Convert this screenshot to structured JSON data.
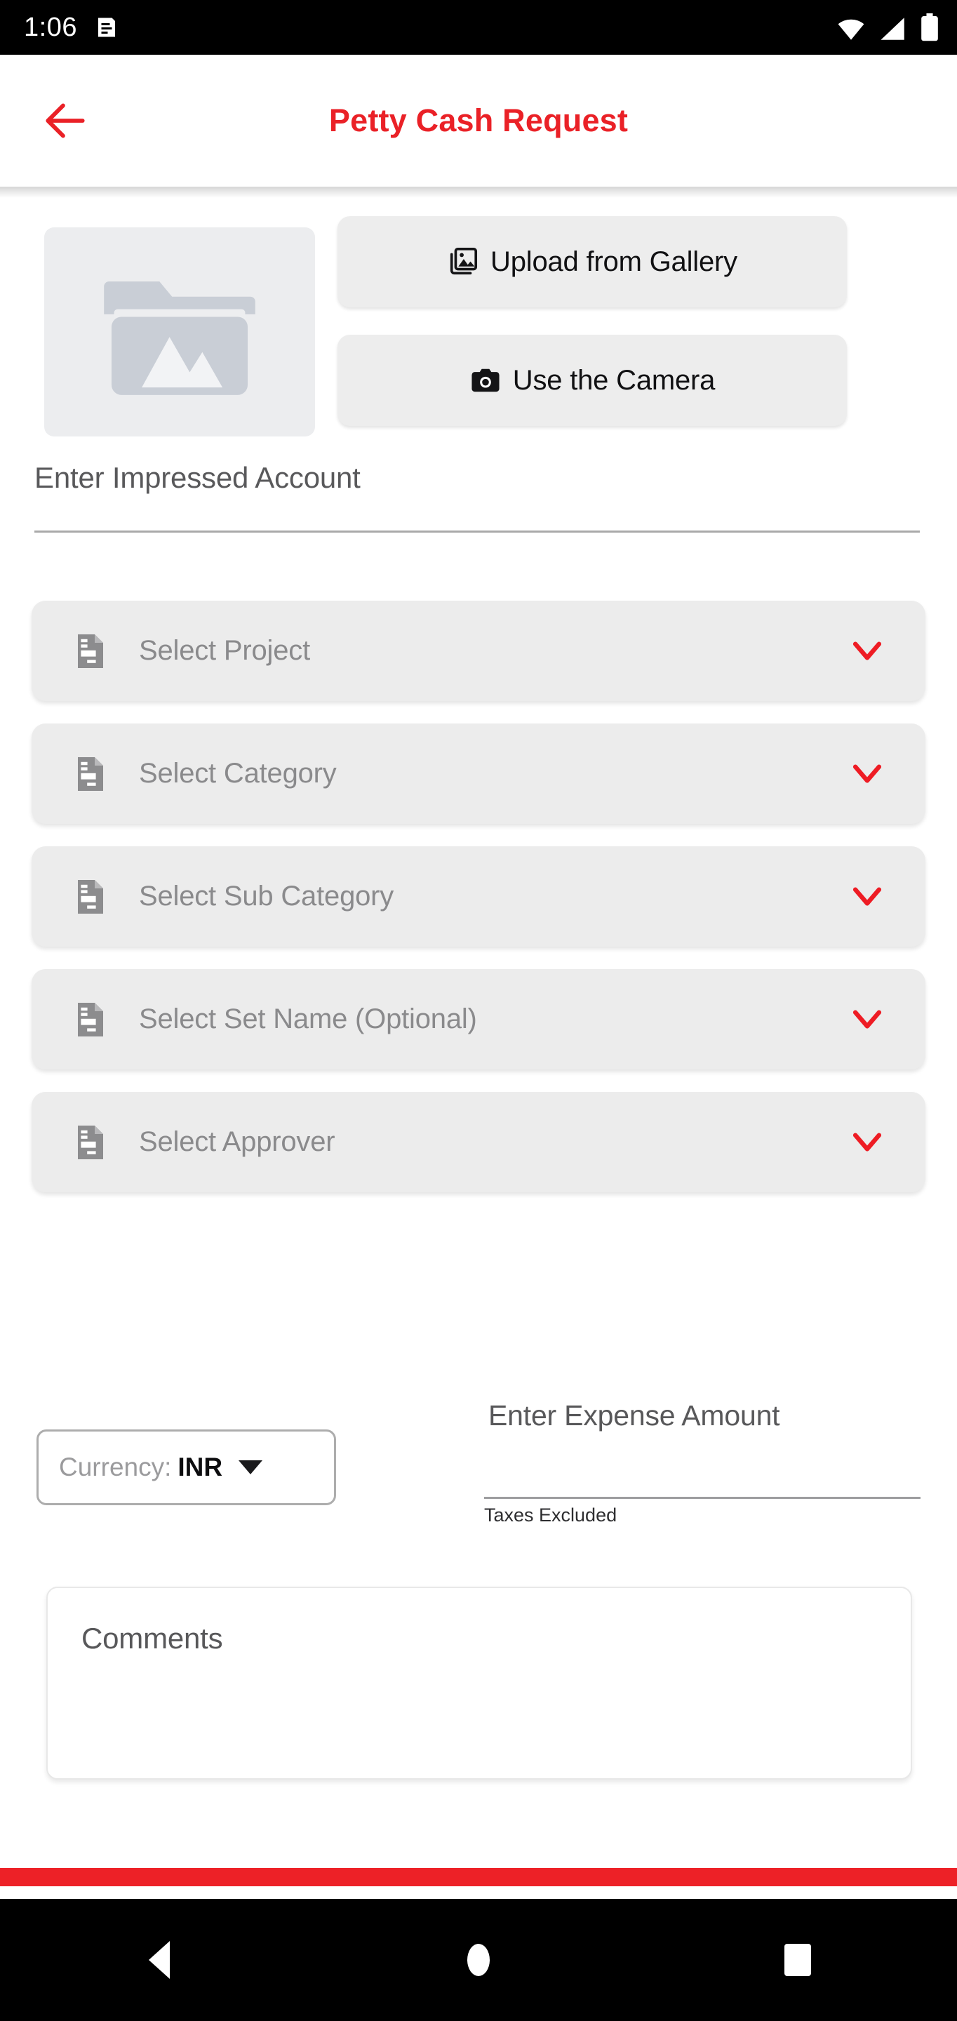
{
  "status_bar": {
    "time": "1:06",
    "icons": [
      "notification-icon",
      "wifi-icon",
      "cellular-signal-icon",
      "battery-icon"
    ]
  },
  "app_bar": {
    "back_icon": "back-arrow-icon",
    "title": "Petty Cash Request",
    "title_color": "#EA2127"
  },
  "attachment": {
    "placeholder_icon": "photo-folder-icon",
    "gallery_button": {
      "label": "Upload from Gallery",
      "icon": "photo-library-icon"
    },
    "camera_button": {
      "label": "Use the Camera",
      "icon": "camera-icon"
    }
  },
  "impressed_account": {
    "label": "Enter Impressed Account",
    "value": ""
  },
  "dropdowns": [
    {
      "label": "Select Project",
      "icon": "document-icon",
      "caret": "chevron-down-icon"
    },
    {
      "label": "Select Category",
      "icon": "document-icon",
      "caret": "chevron-down-icon"
    },
    {
      "label": "Select Sub Category",
      "icon": "document-icon",
      "caret": "chevron-down-icon"
    },
    {
      "label": "Select Set Name (Optional)",
      "icon": "document-icon",
      "caret": "chevron-down-icon"
    },
    {
      "label": "Select Approver",
      "icon": "document-icon",
      "caret": "chevron-down-icon"
    }
  ],
  "money": {
    "currency_label": "Currency:",
    "currency_value": "INR",
    "currency_caret": "caret-down-icon",
    "amount_label": "Enter Expense Amount",
    "amount_value": "",
    "amount_help": "Taxes Excluded"
  },
  "comments": {
    "placeholder": "Comments",
    "value": ""
  },
  "submit": {
    "color": "#ED2127"
  },
  "nav_bar": {
    "back": "nav-back-icon",
    "home": "nav-home-icon",
    "recents": "nav-recents-icon"
  },
  "colors": {
    "brand_red": "#ED2127",
    "field_gray": "#ECECEC",
    "placeholder_gray": "#8A8A8C"
  }
}
